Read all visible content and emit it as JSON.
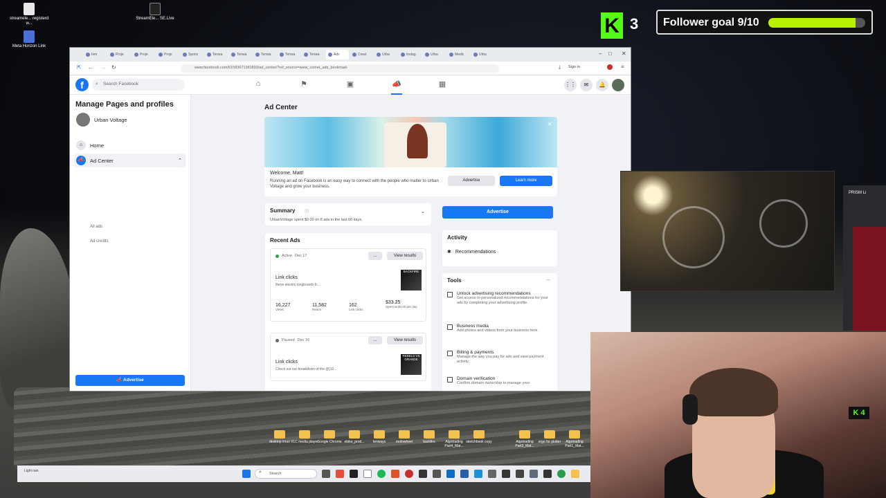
{
  "desktop": {
    "icons_top": [
      {
        "label": "streamele... registerd w...",
        "x": 0
      },
      {
        "label": "StreamEle... SE.Live",
        "x": 1
      }
    ],
    "icon_meta": {
      "label": "Meta Horizon Link"
    },
    "taskbar_folders": [
      "desktop imao",
      "VLC media player",
      "Google Chrome",
      "ebike_prod...",
      "tenways",
      "molowheel",
      "backfire",
      "Algotrading Part4_Mat...",
      "sketchbook copy",
      "Algotrading Part3_Mat...",
      "ergo for plotter",
      "Algotrading Part1_Mat..."
    ],
    "taskbar": {
      "search_placeholder": "Search",
      "weather": "Light rain"
    }
  },
  "browser": {
    "tabs": [
      "Iom",
      "Proje",
      "Proje",
      "Proje",
      "Spons",
      "Tenwa",
      "Tenwa",
      "Tenwa",
      "Tenwa",
      "Tenwa",
      "Adc",
      "Creat",
      "Urba",
      "Instag",
      "Urba",
      "Medic",
      "Urba"
    ],
    "url": "www.facebook.com/61583671381893/ad_center/?ref_source=www_comet_ads_bookmark",
    "sign_in": "Sign in"
  },
  "facebook": {
    "logo": "f",
    "search_placeholder": "Search Facebook",
    "sidebar": {
      "title": "Manage Pages and profiles",
      "page_name": "Urban Voltage",
      "items": [
        {
          "label": "Home"
        },
        {
          "label": "Ad Center"
        }
      ],
      "sub_items": [
        "All ads",
        "Ad credits"
      ],
      "advertise": "Advertise"
    },
    "main": {
      "title": "Ad Center",
      "welcome": "Welcome, Matt!",
      "welcome_text": "Running an ad on Facebook is an easy way to connect with the people who matter to Urban Voltage and grow your business.",
      "advertise_small": "Advertise",
      "learn_more": "Learn more",
      "summary_title": "Summary",
      "summary_sub": "UrbanVoltage spent $0.00 on 8 ads in the last 60 days.",
      "advertise_big": "Advertise",
      "recent_title": "Recent Ads",
      "ads": [
        {
          "status": "Active",
          "date": "Dec 17",
          "status_color": "#31a24c",
          "type": "Link clicks",
          "desc": "these electric longboards fr...",
          "thumb": "BACKFIRE",
          "more": "...",
          "view": "View results",
          "stats": [
            {
              "value": "16,227",
              "label": "Views"
            },
            {
              "value": "11,582",
              "label": "Reach"
            },
            {
              "value": "162",
              "label": "Link clicks"
            },
            {
              "value": "$33.25",
              "label": "Spent at $3.00 per day"
            }
          ]
        },
        {
          "status": "Paused",
          "date": "Dec 16",
          "status_color": "#65676b",
          "type": "Link clicks",
          "desc": "Check out our breakdown of the @[10...",
          "thumb": "REBELS VS GRANDE",
          "more": "...",
          "view": "View results"
        }
      ],
      "activity_title": "Activity",
      "recommendations": "Recommendations",
      "tools_title": "Tools",
      "tools_more": "...",
      "tools": [
        {
          "title": "Unlock advertising recommendations",
          "desc": "Get access to personalized recommendations for your ads by completing your advertising profile."
        },
        {
          "title": "Business media",
          "desc": "Add photos and videos from your business here."
        },
        {
          "title": "Billing & payments",
          "desc": "Manage the way you pay for ads and view payment activity."
        },
        {
          "title": "Domain verification",
          "desc": "Confirm domain ownership to manage your"
        }
      ]
    }
  },
  "stream": {
    "kick_count": "3",
    "kick_small": "4",
    "follower_goal": "Follower goal 9/10",
    "follower_progress": 0.9,
    "prism_label": "PRISM Li"
  }
}
